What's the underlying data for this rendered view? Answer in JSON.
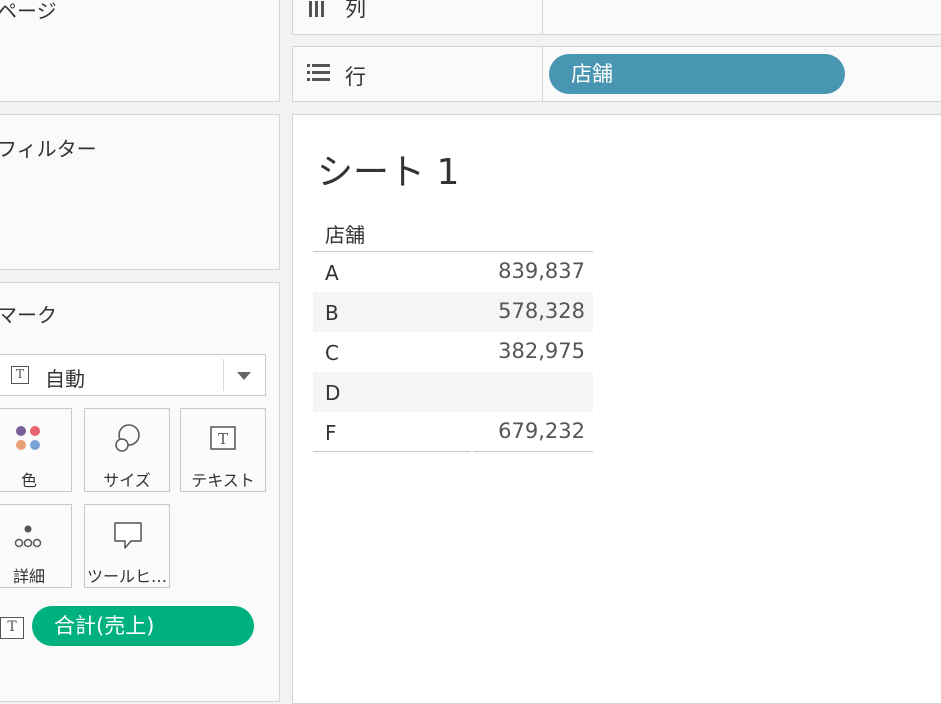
{
  "panels": {
    "pages": "ページ",
    "filters": "フィルター",
    "marks": "マーク"
  },
  "marks": {
    "type_label": "自動",
    "buttons": {
      "color": "色",
      "size": "サイズ",
      "text": "テキスト",
      "detail": "詳細",
      "tooltip": "ツールヒ…"
    },
    "measure_pill": "合計(売上)"
  },
  "shelves": {
    "columns_label": "列",
    "rows_label": "行",
    "rows_pill": "店舗"
  },
  "sheet": {
    "title": "シート 1",
    "column_header": "店舗",
    "rows": [
      {
        "label": "A",
        "value": "839,837"
      },
      {
        "label": "B",
        "value": "578,328"
      },
      {
        "label": "C",
        "value": "382,975"
      },
      {
        "label": "D",
        "value": ""
      },
      {
        "label": "F",
        "value": "679,232"
      }
    ]
  },
  "colors": {
    "dimension_pill": "#4996b2",
    "measure_pill": "#00b180"
  }
}
